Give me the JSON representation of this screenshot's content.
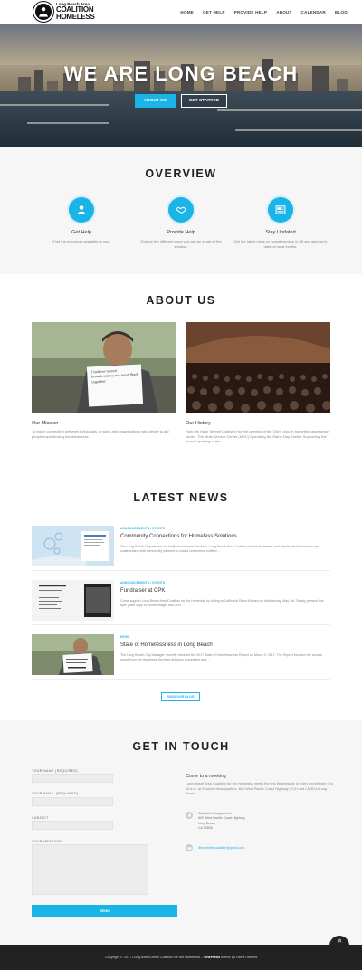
{
  "header": {
    "logo": {
      "line1": "Long Beach Area",
      "line2": "COALITION",
      "line3": "HOMELESS"
    },
    "nav": [
      "HOME",
      "GET HELP",
      "PROVIDE HELP",
      "ABOUT",
      "CALENDAR",
      "BLOG"
    ]
  },
  "hero": {
    "title": "WE ARE LONG BEACH",
    "primary_button": "ABOUT US",
    "secondary_button": "GET STARTED"
  },
  "overview": {
    "title": "OVERVIEW",
    "items": [
      {
        "icon": "user-icon",
        "heading": "Get Help",
        "text": "Find the resources available to you."
      },
      {
        "icon": "handshake-icon",
        "heading": "Provide Help",
        "text": "Explore the different ways you can be a part of the solution."
      },
      {
        "icon": "newspaper-icon",
        "heading": "Stay Updated",
        "text": "Get the latest news on homelessness in LB and stay up to date on local events."
      }
    ]
  },
  "about": {
    "title": "ABOUT US",
    "mission": {
      "heading": "Our Mission",
      "text": "To foster connection between individuals, groups, and organizations who desire to aid people experiencing homelessness."
    },
    "history": {
      "heading": "Our History",
      "text": "How We Have Served Lobbying for the opening of the City's drop in homeless assistance center. The Multi-Service Center (MSC) Operating the Rainy Day Shelter Supporting the annual opening of the ..."
    },
    "sign_text": "I believe to end homelessness we must Work together"
  },
  "news": {
    "title": "LATEST NEWS",
    "items": [
      {
        "category": "ANNOUNCEMENTS / EVENTS",
        "title": "Community Connections for Homeless Solutions",
        "excerpt": "The Long Beach Department of Health and Human Services, Long Beach Area Coalition for the Homeless and Mental Health America are collaborating with community partners to hold a conference entitled ..."
      },
      {
        "category": "ANNOUNCEMENTS / EVENTS",
        "title": "Fundraiser at CPK",
        "excerpt": "Come support Long Beach Area Coalition for the Homeless by dining at California Pizza Kitchen on Wednesday, May 3rd. Simply present this flyer (hard copy or phone image) and 20% ..."
      },
      {
        "category": "NEWS",
        "title": "State of Homelessness in Long Beach",
        "excerpt": "The Long Beach City Manager recently released the 2017 State of Homelessness Report on March 9, 2017. The Report includes the annual report from the Homeless Services Advisory Committee and ..."
      }
    ],
    "read_more": "READ OUR BLOG"
  },
  "contact": {
    "title": "GET IN TOUCH",
    "form": {
      "name_label": "YOUR NAME (REQUIRED)",
      "email_label": "YOUR EMAIL (REQUIRED)",
      "subject_label": "SUBJECT",
      "message_label": "YOUR MESSAGE",
      "send_label": "SEND"
    },
    "meeting_heading": "Come to a meeting",
    "meeting_text": "Long Beach Area Coalition for the Homeless meets the first Wednesday of every month from 9 to 10 a.m. at Goodwill Headquarters. 800 West Pacific Coast Highway (PCH and LA St) in Long Beach.",
    "address": [
      "Goodwill Headquarters",
      "800 West Pacific Coast Highway",
      "Long Beach",
      "CA 90806"
    ],
    "email": "lbhomelesscoalition@gmail.com"
  },
  "footer": {
    "copyright": "Copyright © 2017 Long Beach Area Coalition for the Homeless – ",
    "theme_name": "OnePress",
    "theme_by": " theme by FameThemes"
  },
  "colors": {
    "accent": "#1bb4e6",
    "footer": "#222222"
  }
}
